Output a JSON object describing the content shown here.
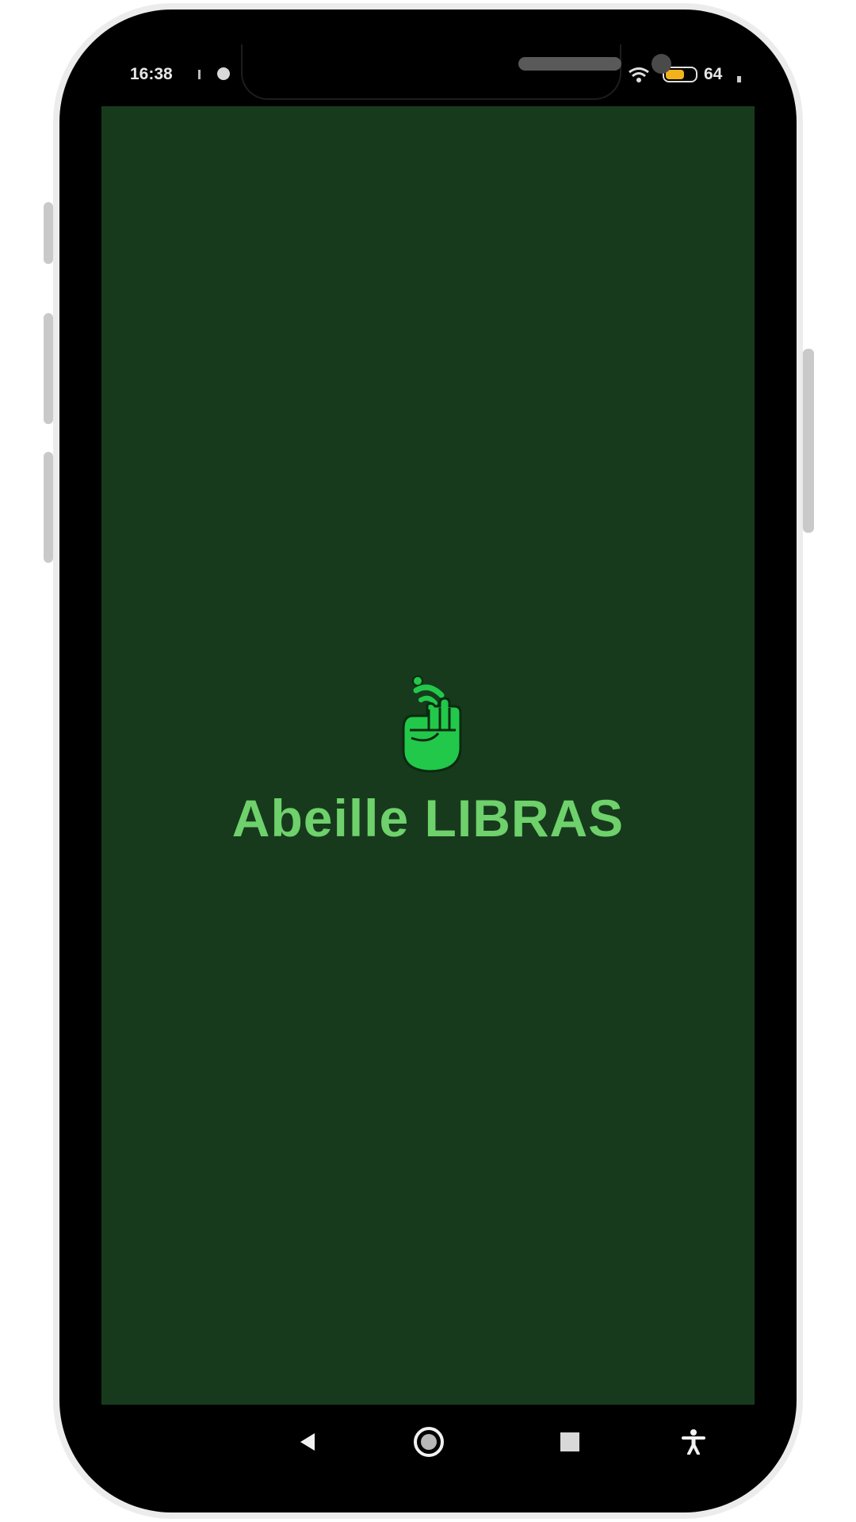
{
  "status_bar": {
    "time": "16:38",
    "battery_level": "64",
    "battery_fraction": 0.64,
    "icons": [
      "signal-icon",
      "notification-icon",
      "wifi-icon",
      "battery-icon"
    ]
  },
  "app": {
    "title": "Abeille LIBRAS",
    "logo_icon": "hand-sign-icon",
    "background_color": "#173a1d",
    "accent_color": "#22c84a",
    "title_color": "#6ed16b"
  },
  "navigation": {
    "back": "back-icon",
    "home": "home-icon",
    "recents": "recents-icon",
    "accessibility": "accessibility-icon"
  }
}
